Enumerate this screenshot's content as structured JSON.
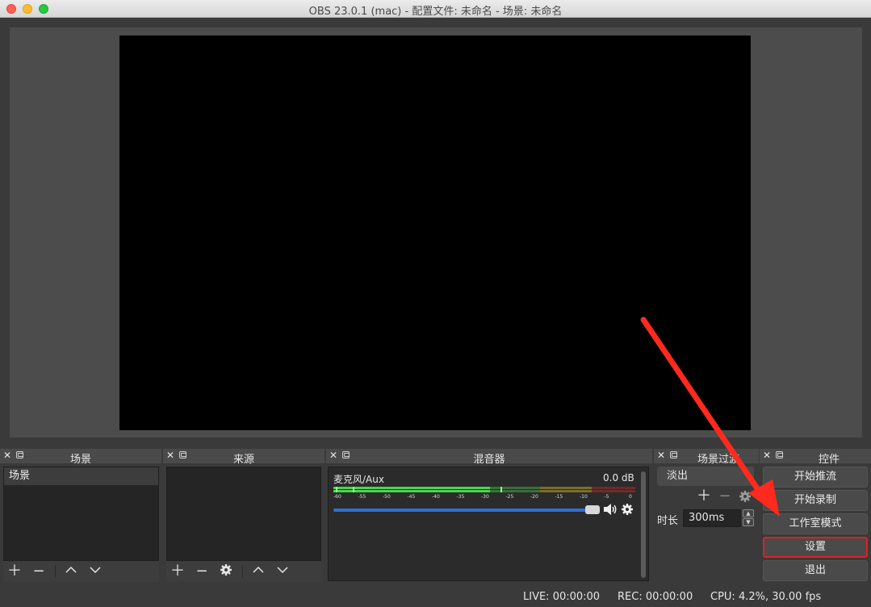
{
  "window": {
    "title": "OBS 23.0.1 (mac) - 配置文件: 未命名 - 场景: 未命名"
  },
  "docks": {
    "scenes": {
      "title": "场景",
      "items": [
        "场景"
      ]
    },
    "sources": {
      "title": "来源"
    },
    "mixer": {
      "title": "混音器",
      "channel_name": "麦克风/Aux",
      "channel_db": "0.0 dB",
      "scale": [
        "-60",
        "-55",
        "-50",
        "-45",
        "-40",
        "-35",
        "-30",
        "-25",
        "-20",
        "-15",
        "-10",
        "-5",
        "0"
      ],
      "volume_level": 0.95
    },
    "transitions": {
      "title": "场景过渡",
      "selected": "淡出",
      "duration_label": "时长",
      "duration_value": "300ms"
    },
    "controls": {
      "title": "控件",
      "buttons": [
        "开始推流",
        "开始录制",
        "工作室模式",
        "设置",
        "退出"
      ]
    }
  },
  "status": {
    "live": "LIVE: 00:00:00",
    "rec": "REC: 00:00:00",
    "cpu": "CPU: 4.2%, 30.00 fps"
  },
  "colors": {
    "annotation_arrow": "#ff2a1e",
    "highlight_box": "#e02020",
    "meter_green": "#4ed44e",
    "meter_yellow": "#c8b43c",
    "meter_red": "#c83c3c",
    "slider_blue": "#2e6fd3"
  }
}
